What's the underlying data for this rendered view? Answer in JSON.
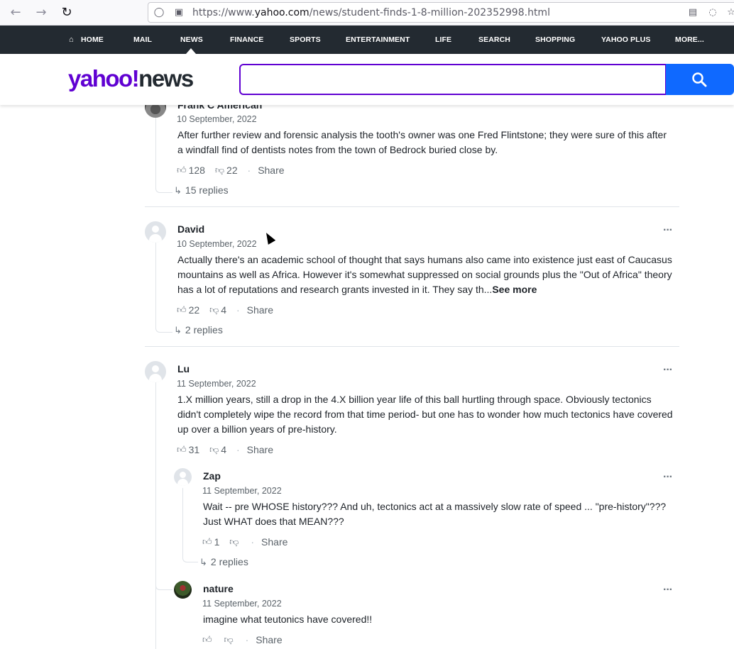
{
  "browser": {
    "url_prefix": "https://www.",
    "url_domain": "yahoo.com",
    "url_path": "/news/student-finds-1-8-million-202352998.html"
  },
  "nav": {
    "items": [
      "HOME",
      "MAIL",
      "NEWS",
      "FINANCE",
      "SPORTS",
      "ENTERTAINMENT",
      "LIFE",
      "SEARCH",
      "SHOPPING",
      "YAHOO PLUS",
      "MORE..."
    ],
    "active": "NEWS"
  },
  "header": {
    "logo_main": "yahoo!",
    "logo_section": "news",
    "search_placeholder": ""
  },
  "comments": [
    {
      "author": "Frank C American",
      "date": "10 September, 2022",
      "text": "After further review and forensic analysis the tooth's owner was one Fred Flintstone; they were sure of this after a windfall find of dentists notes from the town of Bedrock buried close by.",
      "likes": "128",
      "dislikes": "22",
      "share": "Share",
      "replies": "15 replies"
    },
    {
      "author": "David",
      "date": "10 September, 2022",
      "text": "Actually there's an academic school of thought that says humans also came into existence  just east of Caucasus mountains as well as Africa.   However it's somewhat suppressed on social grounds plus the \"Out of Africa\" theory has a lot of reputations and research grants invested in it.  They say th...",
      "see_more": "See more",
      "likes": "22",
      "dislikes": "4",
      "share": "Share",
      "replies": "2 replies"
    },
    {
      "author": "Lu",
      "date": "11 September, 2022",
      "text": "1.X million years, still a drop in the 4.X billion year life of this ball hurtling through space. Obviously tectonics didn't completely wipe the record from that time period- but one has to wonder how much tectonics have covered up over a billion years of pre-history.",
      "likes": "31",
      "dislikes": "4",
      "share": "Share"
    }
  ],
  "replies": [
    {
      "author": "Zap",
      "date": "11 September, 2022",
      "text": "Wait -- pre WHOSE history??? And uh, tectonics act at a massively slow rate of speed ... \"pre-history\"??? Just WHAT does that MEAN???",
      "likes": "1",
      "dislikes": "",
      "share": "Share",
      "replies": "2 replies"
    },
    {
      "author": "nature",
      "date": "11 September, 2022",
      "text": "imagine what teutonics have covered!!",
      "likes": "",
      "dislikes": "",
      "share": "Share"
    }
  ],
  "icons": {
    "more": "more-options-icon",
    "like": "thumbs-up-icon",
    "dislike": "thumbs-down-icon",
    "reply": "reply-arrow-icon"
  },
  "colors": {
    "brand": "#6001d2",
    "search_button": "#0f69ff",
    "nav_bg": "#232a31"
  }
}
